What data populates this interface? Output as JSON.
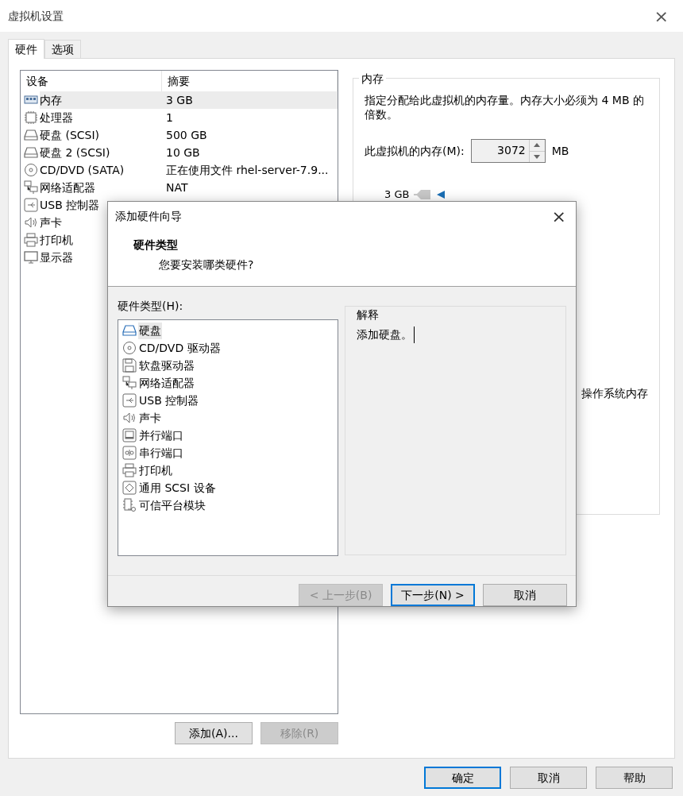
{
  "window": {
    "title": "虚拟机设置",
    "close": "×"
  },
  "tabs": [
    {
      "label": "硬件",
      "selected": true
    },
    {
      "label": "选项",
      "selected": false
    }
  ],
  "devices": {
    "columns": [
      "设备",
      "摘要"
    ],
    "rows": [
      {
        "kind": "memory",
        "name": "内存",
        "summary": "3 GB",
        "selected": true
      },
      {
        "kind": "cpu",
        "name": "处理器",
        "summary": "1",
        "selected": false
      },
      {
        "kind": "disk",
        "name": "硬盘 (SCSI)",
        "summary": "500 GB",
        "selected": false
      },
      {
        "kind": "disk",
        "name": "硬盘 2 (SCSI)",
        "summary": "10 GB",
        "selected": false
      },
      {
        "kind": "cd",
        "name": "CD/DVD (SATA)",
        "summary": "正在使用文件 rhel-server-7.9...",
        "selected": false
      },
      {
        "kind": "network",
        "name": "网络适配器",
        "summary": "NAT",
        "selected": false
      },
      {
        "kind": "usb",
        "name": "USB 控制器",
        "selected": false
      },
      {
        "kind": "sound",
        "name": "声卡",
        "selected": false
      },
      {
        "kind": "printer",
        "name": "打印机",
        "selected": false
      },
      {
        "kind": "display",
        "name": "显示器",
        "selected": false
      }
    ]
  },
  "device_buttons": [
    {
      "label": "添加(A)...",
      "disabled": false
    },
    {
      "label": "移除(R)",
      "disabled": true
    }
  ],
  "memory": {
    "title": "内存",
    "description": "指定分配给此虚拟机的内存量。内存大小必须为 4 MB 的倍数。",
    "field_label": "此虚拟机的内存(M):",
    "value": "3072",
    "unit": "MB",
    "tick_label": "3 GB",
    "partial_text": "操作系统内存"
  },
  "buttons": [
    {
      "label": "确定",
      "default": true
    },
    {
      "label": "取消",
      "default": false
    },
    {
      "label": "帮助",
      "default": false
    }
  ],
  "wizard": {
    "title": "添加硬件向导",
    "close": "×",
    "heading": "硬件类型",
    "subheading": "您要安装哪类硬件?",
    "list_label": "硬件类型(H):",
    "types": [
      {
        "kind": "disk",
        "label": "硬盘",
        "selected": true
      },
      {
        "kind": "cd",
        "label": "CD/DVD 驱动器",
        "selected": false
      },
      {
        "kind": "floppy",
        "label": "软盘驱动器",
        "selected": false
      },
      {
        "kind": "network",
        "label": "网络适配器",
        "selected": false
      },
      {
        "kind": "usb",
        "label": "USB 控制器",
        "selected": false
      },
      {
        "kind": "sound",
        "label": "声卡",
        "selected": false
      },
      {
        "kind": "parallel",
        "label": "并行端口",
        "selected": false
      },
      {
        "kind": "serial",
        "label": "串行端口",
        "selected": false
      },
      {
        "kind": "printer",
        "label": "打印机",
        "selected": false
      },
      {
        "kind": "scsi",
        "label": "通用 SCSI 设备",
        "selected": false
      },
      {
        "kind": "tpm",
        "label": "可信平台模块",
        "selected": false
      }
    ],
    "explanation_title": "解释",
    "explanation": "添加硬盘。",
    "buttons": [
      {
        "label": "< 上一步(B)",
        "disabled": true,
        "default": false
      },
      {
        "label": "下一步(N) >",
        "disabled": false,
        "default": true
      },
      {
        "label": "取消",
        "disabled": false,
        "default": false
      }
    ]
  }
}
